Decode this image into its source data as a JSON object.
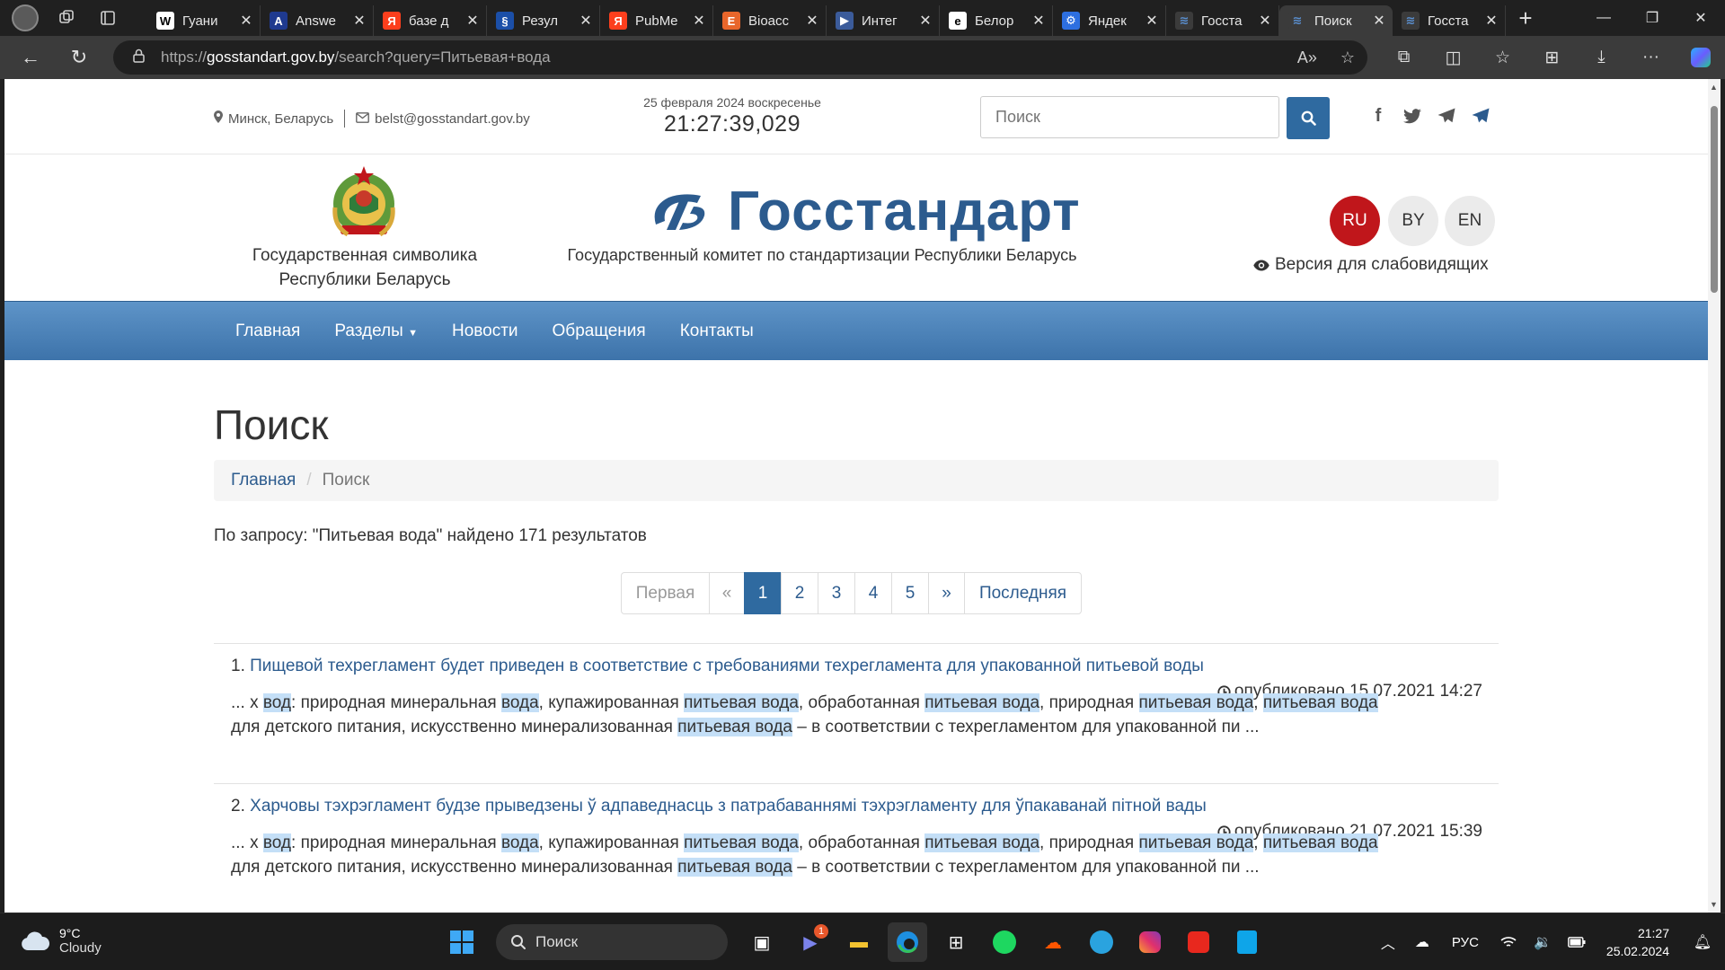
{
  "browser": {
    "tabs": [
      {
        "favicon": "W",
        "favicon_bg": "#ffffff",
        "favicon_fg": "#000000",
        "title": "Гуани"
      },
      {
        "favicon": "A",
        "favicon_bg": "#1f3a8f",
        "favicon_fg": "#ffffff",
        "title": "Answe"
      },
      {
        "favicon": "Я",
        "favicon_bg": "#fc3f1d",
        "favicon_fg": "#ffffff",
        "title": "базе д"
      },
      {
        "favicon": "§",
        "favicon_bg": "#1b4fa8",
        "favicon_fg": "#ffffff",
        "title": "Резул"
      },
      {
        "favicon": "Я",
        "favicon_bg": "#fc3f1d",
        "favicon_fg": "#ffffff",
        "title": "PubMe"
      },
      {
        "favicon": "E",
        "favicon_bg": "#e8662b",
        "favicon_fg": "#ffffff",
        "title": "Bioacc"
      },
      {
        "favicon": "▶",
        "favicon_bg": "#3b5b9a",
        "favicon_fg": "#ffffff",
        "title": "Интег"
      },
      {
        "favicon": "e",
        "favicon_bg": "#ffffff",
        "favicon_fg": "#000000",
        "title": "Белор"
      },
      {
        "favicon": "⚙",
        "favicon_bg": "#2d6fe0",
        "favicon_fg": "#ffffff",
        "title": "Яндек"
      },
      {
        "favicon": "≋",
        "favicon_bg": "#3b3b3b",
        "favicon_fg": "#5a8fd0",
        "title": "Госста"
      },
      {
        "favicon": "≋",
        "favicon_bg": "#3b3b3b",
        "favicon_fg": "#5a8fd0",
        "title": "Поиск"
      },
      {
        "favicon": "≋",
        "favicon_bg": "#3b3b3b",
        "favicon_fg": "#5a8fd0",
        "title": "Госста"
      }
    ],
    "active_tab": 10,
    "url_prefix": "https://",
    "url_host": "gosstandart.gov.by",
    "url_path": "/search?query=Питьевая+вода"
  },
  "header": {
    "location": "Минск, Беларусь",
    "email": "belst@gosstandart.gov.by",
    "date": "25 февраля 2024 воскресенье",
    "time": "21:27:39,029",
    "search_placeholder": "Поиск"
  },
  "branding": {
    "emblem_caption_1": "Государственная символика",
    "emblem_caption_2": "Республики Беларусь",
    "name": "Госстандарт",
    "subtitle": "Государственный комитет по стандартизации Республики Беларусь",
    "languages": [
      "RU",
      "BY",
      "EN"
    ],
    "active_language": "RU",
    "vision_link": "Версия для слабовидящих",
    "accent_color": "#2c5b8e",
    "red_color": "#c0161b"
  },
  "menu": {
    "items": [
      "Главная",
      "Разделы",
      "Новости",
      "Обращения",
      "Контакты"
    ]
  },
  "main": {
    "title": "Поиск",
    "breadcrumb_home": "Главная",
    "breadcrumb_current": "Поиск",
    "summary": "По запросу: \"Питьевая вода\" найдено 171 результатов",
    "pager": {
      "first": "Первая",
      "prev": "«",
      "pages": [
        "1",
        "2",
        "3",
        "4",
        "5"
      ],
      "current": "1",
      "next": "»",
      "last": "Последняя"
    },
    "results": [
      {
        "num": "1.",
        "title": "Пищевой техрегламент будет приведен в соответствие с требованиями техрегламента для упакованной питьевой воды",
        "published": "опубликовано 15.07.2021 14:27",
        "snippet": [
          {
            "t": "... х "
          },
          {
            "t": "вод",
            "hl": true
          },
          {
            "t": ": природная минеральная "
          },
          {
            "t": "вода",
            "hl": true
          },
          {
            "t": ", купажированная "
          },
          {
            "t": "питьевая вода",
            "hl": true
          },
          {
            "t": ", обработанная "
          },
          {
            "t": "питьевая вода",
            "hl": true
          },
          {
            "t": ", природная "
          },
          {
            "t": "питьевая вода",
            "hl": true
          },
          {
            "t": ", "
          },
          {
            "t": "питьевая вода",
            "hl": true
          },
          {
            "t": " для детского питания, искусственно минерализованная "
          },
          {
            "t": "питьевая вода",
            "hl": true
          },
          {
            "t": " – в соответствии с техрегламентом для упакованной пи ..."
          }
        ]
      },
      {
        "num": "2.",
        "title": "Харчовы тэхрэгламент будзе прыведзены ў адпаведнасць з патрабаваннямі тэхрэгламенту для ўпакаванай пітной вады",
        "published": "опубликовано 21.07.2021 15:39",
        "snippet": [
          {
            "t": "... х "
          },
          {
            "t": "вод",
            "hl": true
          },
          {
            "t": ": природная минеральная "
          },
          {
            "t": "вода",
            "hl": true
          },
          {
            "t": ", купажированная "
          },
          {
            "t": "питьевая вода",
            "hl": true
          },
          {
            "t": ", обработанная "
          },
          {
            "t": "питьевая вода",
            "hl": true
          },
          {
            "t": ", природная "
          },
          {
            "t": "питьевая вода",
            "hl": true
          },
          {
            "t": ", "
          },
          {
            "t": "питьевая вода",
            "hl": true
          },
          {
            "t": " для детского питания, искусственно минерализованная "
          },
          {
            "t": "питьевая вода",
            "hl": true
          },
          {
            "t": " – в соответствии с техрегламентом для упакованной пи ..."
          }
        ]
      }
    ]
  },
  "taskbar": {
    "temperature": "9°C",
    "weather": "Cloudy",
    "search_label": "Поиск",
    "input_language": "РУС",
    "time": "21:27",
    "date": "25.02.2024",
    "teams_badge": "1"
  }
}
